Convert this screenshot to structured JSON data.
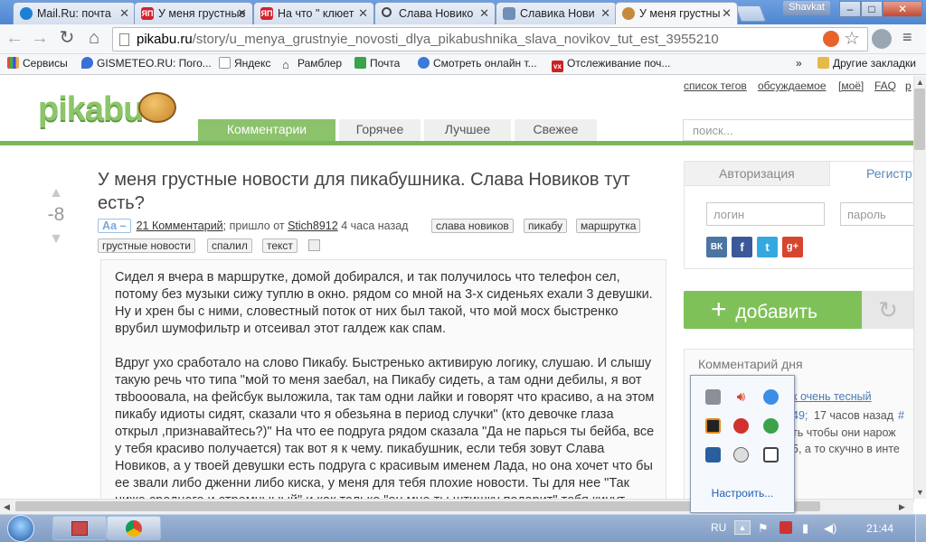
{
  "browser": {
    "tabs": [
      {
        "title": "Mail.Ru: почта"
      },
      {
        "title": "У меня грустные"
      },
      {
        "title": "На что \" клюет"
      },
      {
        "title": "Слава Новико"
      },
      {
        "title": "Славика Нови"
      },
      {
        "title": "У меня грустны"
      }
    ],
    "user_badge": "Shavkat",
    "window_controls": {
      "minimize": "–",
      "maximize": "□",
      "close": "✕"
    },
    "url_host": "pikabu.ru",
    "url_path": "/story/u_menya_grustnyie_novosti_dlya_pikabushnika_slava_novikov_tut_est_3955210",
    "bookmarks": [
      "Сервисы",
      "GISMETEO.RU: Пого...",
      "Яндекс",
      "Рамблер",
      "Почта",
      "Смотреть онлайн т...",
      "Отслеживание поч..."
    ],
    "bookmarks_more": "»",
    "other_bookmarks": "Другие закладки"
  },
  "site": {
    "logo": "pikabu",
    "top_links": [
      "список тегов",
      "обсуждаемое",
      "[моё]",
      "FAQ",
      "р"
    ],
    "nav_tabs": [
      "Комментарии",
      "Горячее",
      "Лучшее",
      "Свежее"
    ],
    "search_placeholder": "поиск..."
  },
  "post": {
    "rating": "-8",
    "title": "У меня грустные новости для пикабушника. Слава Новиков тут есть?",
    "font_toggle": "Аа –",
    "comments_link": "21 Комментарий",
    "meta_from": "; пришло от ",
    "author": "Stich8912",
    "time_ago": "4 часа назад",
    "tags": [
      "слава новиков",
      "пикабу",
      "маршрутка",
      "грустные новости",
      "спалил",
      "текст"
    ],
    "paragraph1": "Сидел я вчера в маршрутке, домой добирался, и так получилось что телефон сел, потому без музыки сижу туплю в окно. рядом со мной на 3-х сиденьях ехали 3 девушки. Ну и хрен бы с ними, словестный поток от них был такой, что мой мосх быстренко врубил шумофильтр и отсеивал этот галдеж как спам.",
    "paragraph2": "Вдруг ухо сработало на слово Пикабу. Быстренько активирую логику, слушаю. И слышу такую речь что типа \"мой то меня заебал, на Пикабу сидеть, а там одни дебилы, я вот твbooовала, на фейсбук выложила, так там одни лайки и говорят что красиво, а на этом пикабу идиоты сидят, сказали что я обезьяна в период случки\" (кто девочке глаза открыл ,признавайтесь?)\" На что ее подруга рядом сказала \"Да не парься ты бейба, все у тебя красиво получается) так вот я к чему. пикабушник, если тебя зовут Слава Новиков, а у твоей девушки есть подруга с красивым именем Лада, но она хочет что бы ее звали либо дженни либо киска, у меня для тебя плохие новости. Ты для нее \"Так ниже среднего и стремныыый\" и как только \"он мне ты штишку подарит\" тебя кинут через"
  },
  "sidebar": {
    "auth_tab": "Авторизация",
    "register_tab": "Регистр",
    "login_placeholder": "логин",
    "password_placeholder": "пароль",
    "social": [
      "ВК",
      "f",
      "t",
      "g+"
    ],
    "add_button": "добавить",
    "comment_of_day_title": "Комментарий дня",
    "cotd_link": "к очень тесный",
    "cotd_meta_a": "49;",
    "cotd_meta_b": "17 часов назад",
    "cotd_hash": "#",
    "cotd_text1": "ть чтобы они нарож",
    "cotd_text2": "5, а то скучно в инте"
  },
  "tray_popup": {
    "configure": "Настроить..."
  },
  "taskbar": {
    "lang": "RU",
    "clock": "21:44"
  }
}
